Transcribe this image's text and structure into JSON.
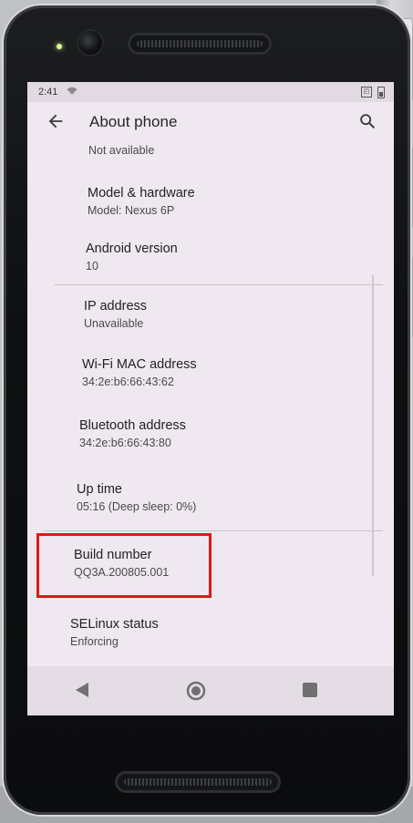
{
  "status_bar": {
    "time": "2:41",
    "vibrate_glyph": "◰"
  },
  "app_bar": {
    "title": "About phone",
    "back_icon": "back-arrow-icon",
    "search_icon": "search-icon"
  },
  "items": [
    {
      "title": "",
      "subtitle": "Not available"
    },
    {
      "title": "Model & hardware",
      "subtitle": "Model: Nexus 6P"
    },
    {
      "title": "Android version",
      "subtitle": "10"
    },
    {
      "title": "IP address",
      "subtitle": "Unavailable"
    },
    {
      "title": "Wi‑Fi MAC address",
      "subtitle": "34:2e:b6:66:43:62"
    },
    {
      "title": "Bluetooth address",
      "subtitle": "34:2e:b6:66:43:80"
    },
    {
      "title": "Up time",
      "subtitle": "05:16 (Deep sleep: 0%)"
    },
    {
      "title": "Build number",
      "subtitle": "QQ3A.200805.001"
    },
    {
      "title": "SELinux status",
      "subtitle": "Enforcing"
    }
  ],
  "highlight": {
    "target": "Build number",
    "color": "#e01818"
  },
  "nav_bar": {
    "back_icon": "nav-back-icon",
    "home_icon": "nav-home-icon",
    "recents_icon": "nav-recents-icon"
  }
}
